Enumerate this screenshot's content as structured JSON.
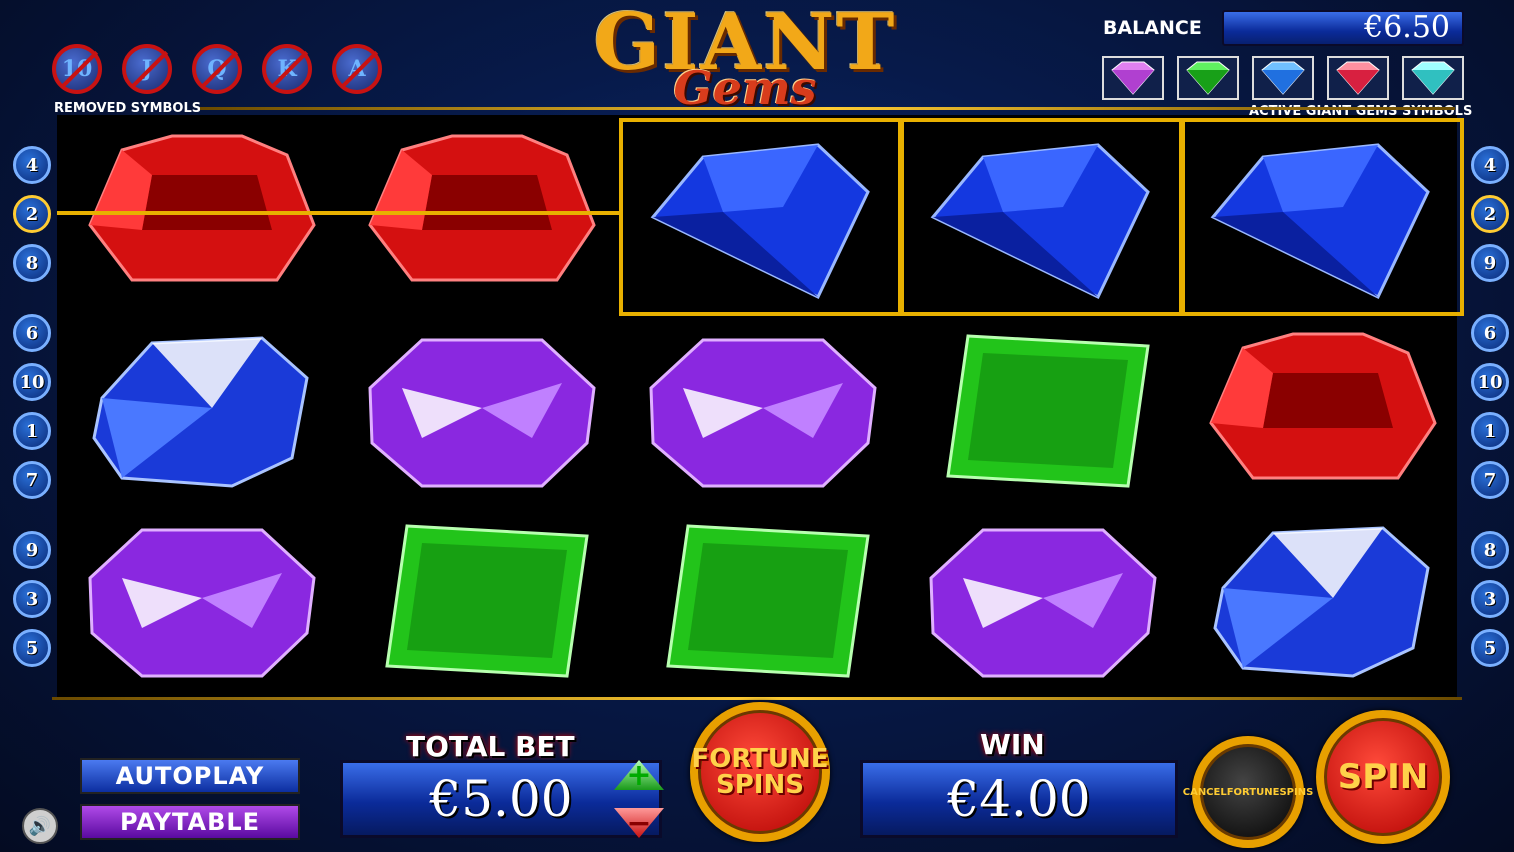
{
  "header": {
    "title_giant": "GIANT",
    "title_gems": "Gems",
    "removed_label": "REMOVED SYMBOLS",
    "removed_symbols": [
      "10",
      "J",
      "Q",
      "K",
      "A"
    ],
    "balance_label": "BALANCE",
    "balance_value": "€6.50",
    "active_label": "ACTIVE GIANT GEMS SYMBOLS",
    "active_gems": [
      "pink-gem",
      "green-gem",
      "blue-gem",
      "red-gem",
      "cyan-gem"
    ]
  },
  "reels": {
    "grid": [
      [
        "red",
        "red",
        "blue-diamond",
        "blue-diamond",
        "blue-diamond"
      ],
      [
        "blue-oval",
        "purple",
        "purple",
        "green",
        "red"
      ],
      [
        "purple",
        "green",
        "green",
        "purple",
        "blue-oval"
      ]
    ],
    "colors": {
      "red": "#d41010",
      "blue": "#1438e0",
      "purple": "#8a28e0",
      "green": "#22c41a",
      "highlight": "#e8b000"
    }
  },
  "paylines": {
    "left": [
      "4",
      "2",
      "8",
      "6",
      "10",
      "1",
      "7",
      "9",
      "3",
      "5"
    ],
    "right": [
      "4",
      "2",
      "9",
      "6",
      "10",
      "1",
      "7",
      "8",
      "3",
      "5"
    ]
  },
  "controls": {
    "autoplay": "AUTOPLAY",
    "paytable": "PAYTABLE",
    "total_bet_label": "TOTAL BET",
    "total_bet_value": "€5.00",
    "plus": "+",
    "minus": "−",
    "fortune_spins": "FORTUNE SPINS",
    "win_label": "WIN",
    "win_value": "€4.00",
    "cancel_fortune_spins": "CANCELFORTUNESPINS",
    "spin": "SPIN",
    "sound_icon": "speaker-icon"
  }
}
